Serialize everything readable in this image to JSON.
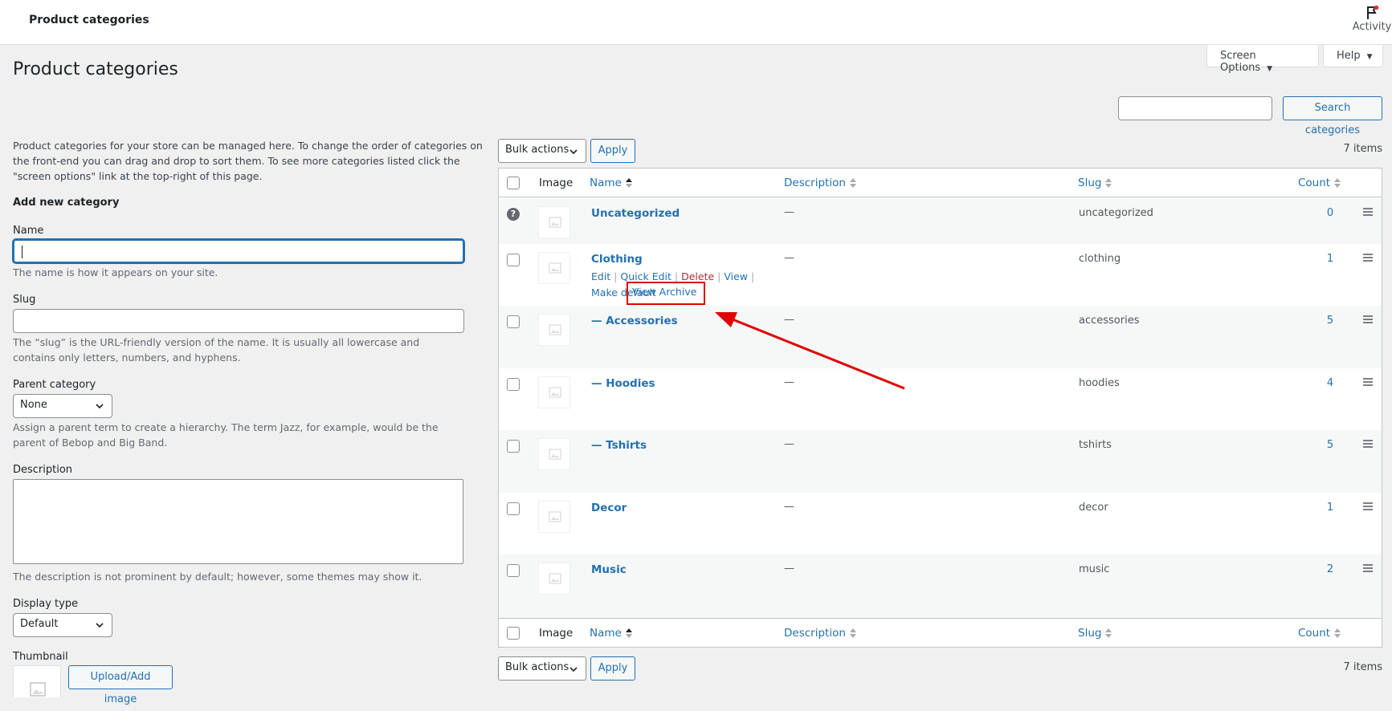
{
  "header": {
    "title": "Product categories",
    "activity_label": "Activity"
  },
  "screen_options": {
    "screen_options_label": "Screen Options",
    "help_label": "Help"
  },
  "page": {
    "title": "Product categories"
  },
  "search": {
    "value": "",
    "button_label": "Search categories"
  },
  "form": {
    "intro": "Product categories for your store can be managed here. To change the order of categories on the front-end you can drag and drop to sort them. To see more categories listed click the \"screen options\" link at the top-right of this page.",
    "heading": "Add new category",
    "name_label": "Name",
    "name_value": "",
    "name_hint": "The name is how it appears on your site.",
    "slug_label": "Slug",
    "slug_hint": "The “slug” is the URL-friendly version of the name. It is usually all lowercase and contains only letters, numbers, and hyphens.",
    "parent_label": "Parent category",
    "parent_value": "None",
    "parent_hint": "Assign a parent term to create a hierarchy. The term Jazz, for example, would be the parent of Bebop and Big Band.",
    "description_label": "Description",
    "description_hint": "The description is not prominent by default; however, some themes may show it.",
    "display_type_label": "Display type",
    "display_type_value": "Default",
    "thumbnail_label": "Thumbnail",
    "upload_button": "Upload/Add image"
  },
  "table": {
    "bulk_actions_label": "Bulk actions",
    "apply_label": "Apply",
    "items_count": "7 items",
    "columns": {
      "image": "Image",
      "name": "Name",
      "description": "Description",
      "slug": "Slug",
      "count": "Count"
    },
    "rows": [
      {
        "name": "Uncategorized",
        "description": "—",
        "slug": "uncategorized",
        "count": "0"
      },
      {
        "name": "Clothing",
        "description": "—",
        "slug": "clothing",
        "count": "1"
      },
      {
        "name": "— Accessories",
        "description": "—",
        "slug": "accessories",
        "count": "5"
      },
      {
        "name": "— Hoodies",
        "description": "—",
        "slug": "hoodies",
        "count": "4"
      },
      {
        "name": "— Tshirts",
        "description": "—",
        "slug": "tshirts",
        "count": "5"
      },
      {
        "name": "Decor",
        "description": "—",
        "slug": "decor",
        "count": "1"
      },
      {
        "name": "Music",
        "description": "—",
        "slug": "music",
        "count": "2"
      }
    ],
    "row_actions": {
      "edit": "Edit",
      "quick_edit": "Quick Edit",
      "delete": "Delete",
      "view": "View",
      "make_default": "Make default",
      "view_archive": "View Archive",
      "separator": " | "
    }
  },
  "colors": {
    "accent": "#2271b1",
    "annotation": "#e00000",
    "delete": "#b32d2e"
  }
}
